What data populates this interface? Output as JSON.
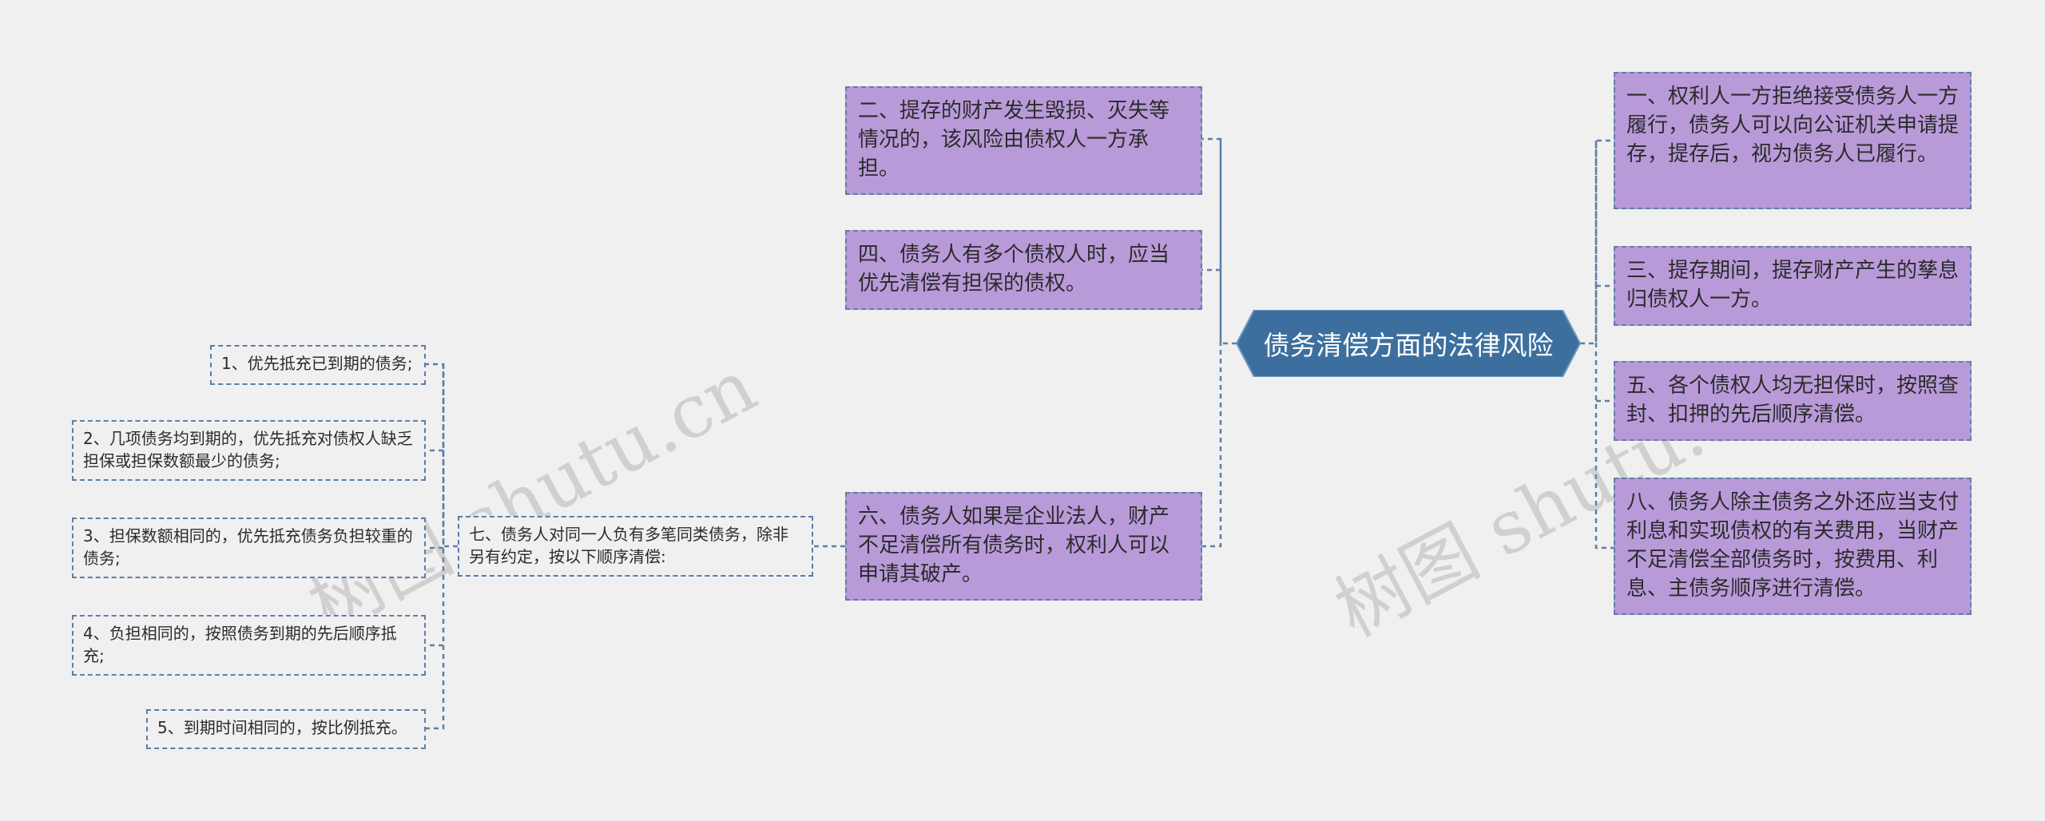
{
  "root": {
    "label": "债务清偿方面的法律风险"
  },
  "right_nodes": [
    "一、权利人一方拒绝接受债务人一方履行，债务人可以向公证机关申请提存，提存后，视为债务人已履行。",
    "三、提存期间，提存财产产生的孳息归债权人一方。",
    "五、各个债权人均无担保时，按照查封、扣押的先后顺序清偿。",
    "八、债务人除主债务之外还应当支付利息和实现债权的有关费用，当财产不足清偿全部债务时，按费用、利息、主债务顺序进行清偿。"
  ],
  "left_nodes": [
    "二、提存的财产发生毁损、灭失等情况的，该风险由债权人一方承担。",
    "四、债务人有多个债权人时，应当优先清偿有担保的债权。",
    "六、债务人如果是企业法人，财产不足清偿所有债务时，权利人可以申请其破产。"
  ],
  "branch_seven": {
    "label": "七、债务人对同一人负有多笔同类债务，除非另有约定，按以下顺序清偿:",
    "children": [
      "1、优先抵充已到期的债务;",
      "2、几项债务均到期的，优先抵充对债权人缺乏担保或担保数额最少的债务;",
      "3、担保数额相同的，优先抵充债务负担较重的债务;",
      "4、负担相同的，按照债务到期的先后顺序抵充;",
      "5、到期时间相同的，按比例抵充。"
    ]
  },
  "watermarks": [
    "树图 shutu.cn",
    "树图 shutu.cn"
  ],
  "colors": {
    "background": "#f0f0f0",
    "root_fill": "#3d6f9e",
    "node_fill": "#b99ad9",
    "connector": "#5b7fa6"
  }
}
